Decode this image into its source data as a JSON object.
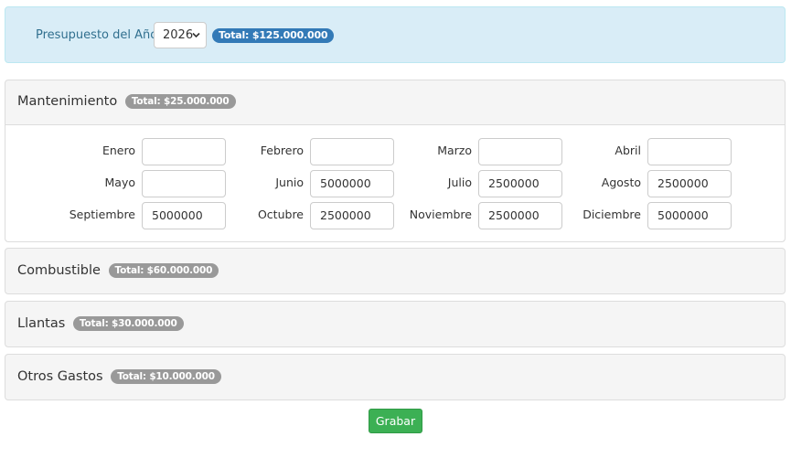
{
  "year_bar": {
    "label": "Presupuesto del Año",
    "selected_year": "2026",
    "total": "Total: $125.000.000"
  },
  "panels": [
    {
      "title": "Mantenimiento",
      "total": "Total: $25.000.000",
      "expanded": true,
      "months": [
        {
          "label": "Enero",
          "value": ""
        },
        {
          "label": "Febrero",
          "value": ""
        },
        {
          "label": "Marzo",
          "value": ""
        },
        {
          "label": "Abril",
          "value": ""
        },
        {
          "label": "Mayo",
          "value": ""
        },
        {
          "label": "Junio",
          "value": "5000000"
        },
        {
          "label": "Julio",
          "value": "2500000"
        },
        {
          "label": "Agosto",
          "value": "2500000"
        },
        {
          "label": "Septiembre",
          "value": "5000000"
        },
        {
          "label": "Octubre",
          "value": "2500000"
        },
        {
          "label": "Noviembre",
          "value": "2500000"
        },
        {
          "label": "Diciembre",
          "value": "5000000"
        }
      ]
    },
    {
      "title": "Combustible",
      "total": "Total: $60.000.000",
      "expanded": false
    },
    {
      "title": "Llantas",
      "total": "Total: $30.000.000",
      "expanded": false
    },
    {
      "title": "Otros Gastos",
      "total": "Total: $10.000.000",
      "expanded": false
    }
  ],
  "save_button": {
    "label": "Grabar"
  },
  "colors": {
    "info_bg": "#d9edf7",
    "info_text": "#31708f",
    "badge_primary": "#337ab7",
    "badge_default": "#999999",
    "success": "#3cb054"
  },
  "icons": {
    "select_arrow": "chevron-down-icon"
  }
}
